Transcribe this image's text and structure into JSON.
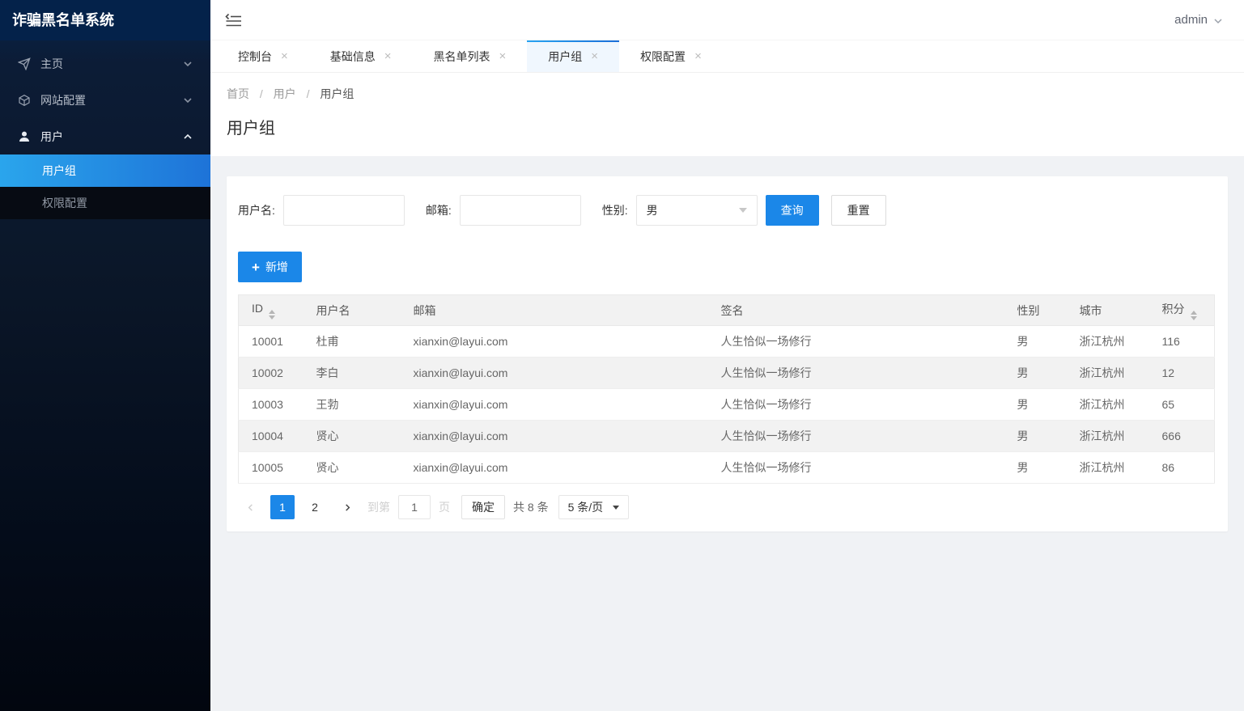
{
  "app": {
    "title": "诈骗黑名单系统"
  },
  "topbar": {
    "username": "admin"
  },
  "sidebar": {
    "items": [
      {
        "label": "主页",
        "icon": "send-icon",
        "state": "collapsed"
      },
      {
        "label": "网站配置",
        "icon": "cube-icon",
        "state": "collapsed"
      },
      {
        "label": "用户",
        "icon": "user-icon",
        "state": "expanded"
      }
    ],
    "submenu": [
      {
        "label": "用户组",
        "active": true
      },
      {
        "label": "权限配置",
        "active": false
      }
    ]
  },
  "tabs": [
    {
      "label": "控制台"
    },
    {
      "label": "基础信息"
    },
    {
      "label": "黑名单列表"
    },
    {
      "label": "用户组",
      "active": true
    },
    {
      "label": "权限配置"
    }
  ],
  "tab_close_glyph": "×",
  "breadcrumb": {
    "items": [
      "首页",
      "用户",
      "用户组"
    ],
    "separator": "/"
  },
  "page": {
    "title": "用户组"
  },
  "search": {
    "username_label": "用户名:",
    "email_label": "邮箱:",
    "gender_label": "性别:",
    "gender_value": "男",
    "query_label": "查询",
    "reset_label": "重置"
  },
  "toolbar": {
    "add_label": "新增",
    "plus_glyph": "+"
  },
  "table": {
    "columns": [
      "ID",
      "用户名",
      "邮箱",
      "签名",
      "性别",
      "城市",
      "积分"
    ],
    "rows": [
      [
        "10001",
        "杜甫",
        "xianxin@layui.com",
        "人生恰似一场修行",
        "男",
        "浙江杭州",
        "116"
      ],
      [
        "10002",
        "李白",
        "xianxin@layui.com",
        "人生恰似一场修行",
        "男",
        "浙江杭州",
        "12"
      ],
      [
        "10003",
        "王勃",
        "xianxin@layui.com",
        "人生恰似一场修行",
        "男",
        "浙江杭州",
        "65"
      ],
      [
        "10004",
        "贤心",
        "xianxin@layui.com",
        "人生恰似一场修行",
        "男",
        "浙江杭州",
        "666"
      ],
      [
        "10005",
        "贤心",
        "xianxin@layui.com",
        "人生恰似一场修行",
        "男",
        "浙江杭州",
        "86"
      ]
    ]
  },
  "pagination": {
    "pages": [
      "1",
      "2"
    ],
    "active_page": "1",
    "goto_label": "到第",
    "goto_value": "1",
    "page_unit_label": "页",
    "confirm_label": "确定",
    "total_label": "共 8 条",
    "per_page_label": "5 条/页"
  },
  "colors": {
    "accent_blue": "#1b87e8",
    "active_menu_gradient_start": "#2aa5ec",
    "active_menu_gradient_end": "#1e73d8",
    "sidebar_top": "#04224a",
    "sidebar_bottom": "#02060f",
    "table_header_bg": "#f2f2f2",
    "content_bg": "#f0f2f5"
  }
}
